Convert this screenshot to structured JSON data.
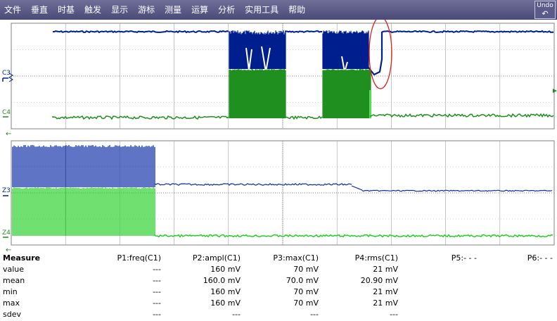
{
  "menu": {
    "items": [
      "文件",
      "垂直",
      "时基",
      "触发",
      "显示",
      "游标",
      "测量",
      "运算",
      "分析",
      "实用工具",
      "帮助"
    ],
    "undo_label": "Undo",
    "undo_icon": "undo-arrow-icon"
  },
  "scope": {
    "upper_channel_labels": [
      "C3",
      "C4"
    ],
    "lower_channel_labels": [
      "Z3",
      "Z4"
    ],
    "colors": {
      "ch3": "#001f8f",
      "ch4": "#1f8f1f",
      "zoom3": "#0a2aa8",
      "zoom4": "#22d022",
      "grid": "#a0a0a0",
      "highlight": "#e02020"
    }
  },
  "measure": {
    "header": [
      "Measure",
      "P1:freq(C1)",
      "P2:ampl(C1)",
      "P3:max(C1)",
      "P4:rms(C1)",
      "P5:- - -",
      "P6:- - -"
    ],
    "rows": [
      [
        "value",
        "---",
        "160 mV",
        "70 mV",
        "21 mV",
        "",
        ""
      ],
      [
        "mean",
        "---",
        "160.0 mV",
        "70.0 mV",
        "20.90 mV",
        "",
        ""
      ],
      [
        "min",
        "---",
        "160 mV",
        "70 mV",
        "21 mV",
        "",
        ""
      ],
      [
        "max",
        "---",
        "160 mV",
        "70 mV",
        "21 mV",
        "",
        ""
      ],
      [
        "sdev",
        "---",
        "---",
        "---",
        "---",
        "",
        ""
      ]
    ]
  }
}
